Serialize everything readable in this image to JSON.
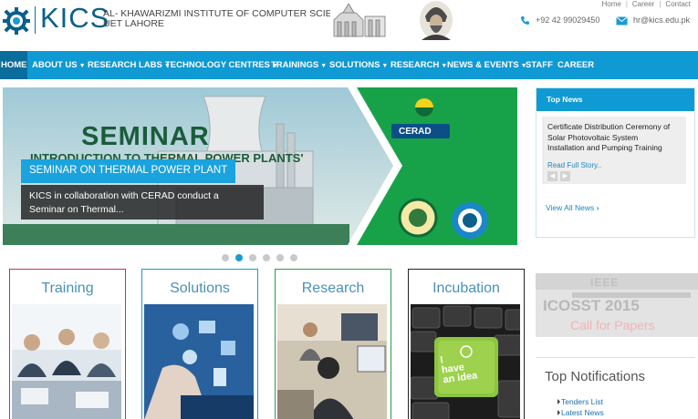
{
  "header": {
    "logo_text": "KICS",
    "institute_line1": "AL- KHAWARIZMI INSTITUTE OF COMPUTER SCIENCE",
    "institute_line2": "UET LAHORE",
    "top_links": [
      "Home",
      "Career",
      "Contact"
    ],
    "phone": "+92 42 99029450",
    "email": "hr@kics.edu.pk"
  },
  "nav": {
    "items": [
      {
        "label": "HOME",
        "dropdown": false
      },
      {
        "label": "ABOUT US",
        "dropdown": true
      },
      {
        "label": "RESEARCH LABS",
        "dropdown": true
      },
      {
        "label": "TECHNOLOGY CENTRES",
        "dropdown": true
      },
      {
        "label": "TRAININGS",
        "dropdown": true
      },
      {
        "label": "SOLUTIONS",
        "dropdown": true
      },
      {
        "label": "RESEARCH",
        "dropdown": true
      },
      {
        "label": "NEWS & EVENTS",
        "dropdown": true
      },
      {
        "label": "STAFF",
        "dropdown": false
      },
      {
        "label": "CAREER",
        "dropdown": false
      }
    ],
    "caret": "▼"
  },
  "slider": {
    "banner_heading": "SEMINAR",
    "banner_subheading": "INTRODUCTION TO THERMAL POWER PLANTS'",
    "caption_title": "SEMINAR ON THERMAL POWER PLANT",
    "caption_text_line1": "KICS in collaboration with CERAD conduct a",
    "caption_text_line2": "Seminar on Thermal...",
    "partner_logo": "CERAD",
    "dots_count": 6,
    "active_dot": 1
  },
  "top_news": {
    "heading": "Top News",
    "item_title_line1": "Certificate Distribution Ceremony of",
    "item_title_line2": "Solar Photovoltaic System",
    "item_title_line3": "Installation and Pumping Training",
    "read_more": "Read Full Story..",
    "view_all": "View All News",
    "prev_icon": "◀",
    "next_icon": "▶"
  },
  "ieee_banner": {
    "org": "IEEE",
    "event": "ICOSST 2015",
    "cta": "Call for Papers"
  },
  "notifications": {
    "heading": "Top Notifications",
    "links": [
      "Tenders List",
      "Latest News"
    ]
  },
  "services": [
    {
      "title": "Training",
      "border": "#c0316f"
    },
    {
      "title": "Solutions",
      "border": "#1a9bd2"
    },
    {
      "title": "Research",
      "border": "#2f9a4a"
    },
    {
      "title": "Incubation",
      "border": "#222222"
    }
  ],
  "incubation_key": {
    "line1": "I",
    "line2": "have",
    "line3": "an idea"
  },
  "colors": {
    "accent": "#0f9ad4",
    "nav_active": "#0a6d9c",
    "link": "#1a88c0"
  }
}
